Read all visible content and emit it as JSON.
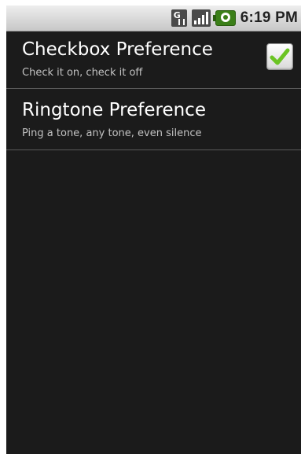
{
  "status_bar": {
    "time": "6:19 PM",
    "icons": [
      "sim-data-icon",
      "signal-icon",
      "battery-charging-icon"
    ]
  },
  "preferences": [
    {
      "title": "Checkbox Preference",
      "summary": "Check it on, check it off",
      "checked": true
    },
    {
      "title": "Ringtone Preference",
      "summary": "Ping a tone, any tone, even silence"
    }
  ],
  "colors": {
    "background": "#1b1b1b",
    "check": "#6bc423"
  }
}
